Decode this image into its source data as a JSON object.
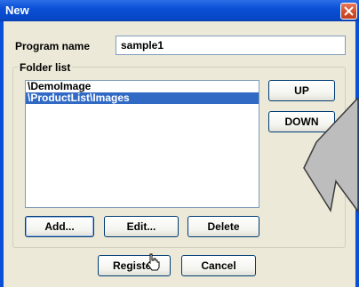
{
  "window": {
    "title": "New"
  },
  "program": {
    "label": "Program name",
    "value": "sample1"
  },
  "folder_list": {
    "label": "Folder list",
    "items": [
      "\\DemoImage",
      "\\ProductList\\Images"
    ],
    "selected_index": 1
  },
  "buttons": {
    "up": "UP",
    "down": "DOWN",
    "add": "Add...",
    "edit": "Edit...",
    "delete": "Delete",
    "register": "Register",
    "cancel": "Cancel"
  }
}
